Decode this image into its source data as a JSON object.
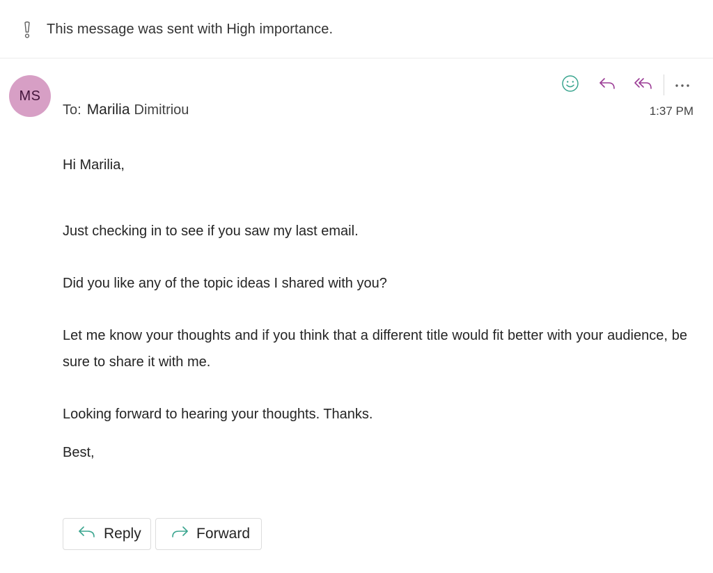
{
  "importance": {
    "icon": "exclamation-icon",
    "text": "This message was sent with High importance."
  },
  "sender": {
    "initials": "MS",
    "avatar_color": "#d79fc5"
  },
  "recipients": {
    "label": "To:",
    "first_name": "Marilia",
    "last_name": "Dimitriou"
  },
  "header_actions": [
    {
      "name": "emoji-reaction",
      "icon": "smiley-icon",
      "color": "#3aa58f"
    },
    {
      "name": "reply",
      "icon": "reply-icon",
      "color": "#9b3b95"
    },
    {
      "name": "reply-all",
      "icon": "reply-all-icon",
      "color": "#9b3b95"
    },
    {
      "name": "more-actions",
      "icon": "more-icon",
      "color": "#5c5c5c"
    }
  ],
  "timestamp": "1:37 PM",
  "message": {
    "greeting": "Hi Marilia,",
    "paragraphs": [
      "Just checking in to see if you saw my last email.",
      "Did you like any of the topic ideas I shared with you?",
      "Let me know your thoughts and if you think that a different title would fit better with your audience, be sure to share it with me.",
      "Looking forward to hearing your thoughts. Thanks."
    ],
    "signoff": "Best,"
  },
  "footer_buttons": {
    "reply_label": "Reply",
    "forward_label": "Forward",
    "accent_color": "#3aa58f"
  }
}
